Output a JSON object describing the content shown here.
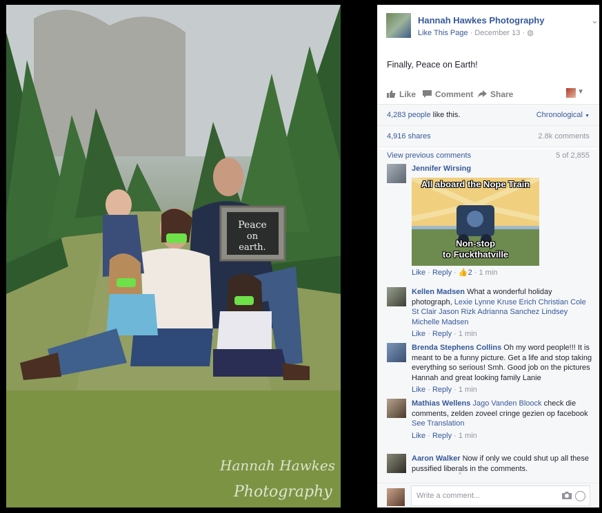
{
  "photo": {
    "sign_line1": "Peace",
    "sign_line2": "on",
    "sign_line3": "earth.",
    "watermark_line1": "Hannah Hawkes",
    "watermark_line2": "Photography"
  },
  "post": {
    "page_name": "Hannah Hawkes Photography",
    "like_page": "Like This Page",
    "date": "December 13",
    "text": "Finally, Peace on Earth!"
  },
  "actions": {
    "like": "Like",
    "comment": "Comment",
    "share": "Share"
  },
  "stats": {
    "likes_count": "4,283 people",
    "likes_suffix": " like this.",
    "sort": "Chronological",
    "shares": "4,916 shares",
    "comments": "2.8k comments"
  },
  "comments_header": {
    "view_previous": "View previous comments",
    "count": "5 of 2,855"
  },
  "comments": [
    {
      "name": "Jennifer Wirsing",
      "meme_top": "All aboard the Nope Train",
      "meme_bottom_1": "Non-stop",
      "meme_bottom_2": "to Fuckthatville",
      "like": "Like",
      "reply": "Reply",
      "reactions": "2",
      "time": "1 min"
    },
    {
      "name": "Kellen Madsen",
      "text": "What a wonderful holiday photograph,",
      "tags": "Lexie Lynne Kruse Erich Christian Cole St Clair Jason Rizk Adrianna Sanchez Lindsey Michelle Madsen",
      "like": "Like",
      "reply": "Reply",
      "time": "1 min"
    },
    {
      "name": "Brenda Stephens Collins",
      "text": "Oh my word people!!! It is meant to be a funny picture. Get a life and stop taking everything so serious! Smh. Good job on the pictures Hannah and great looking family Lanie",
      "like": "Like",
      "reply": "Reply",
      "time": "1 min"
    },
    {
      "name": "Mathias Wellens",
      "tag": "Jago Vanden Bloock",
      "text": "check die comments, zelden zoveel cringe gezien op facebook",
      "see_translation": "See Translation",
      "like": "Like",
      "reply": "Reply",
      "time": "1 min"
    },
    {
      "name": "Aaron Walker",
      "text": "Now if only we could shut up all these pussified liberals in the comments."
    }
  ],
  "composer": {
    "placeholder": "Write a comment..."
  },
  "colors": {
    "link": "#365899",
    "tape": "#6ee04a",
    "panel_bg": "#f6f7f9"
  }
}
